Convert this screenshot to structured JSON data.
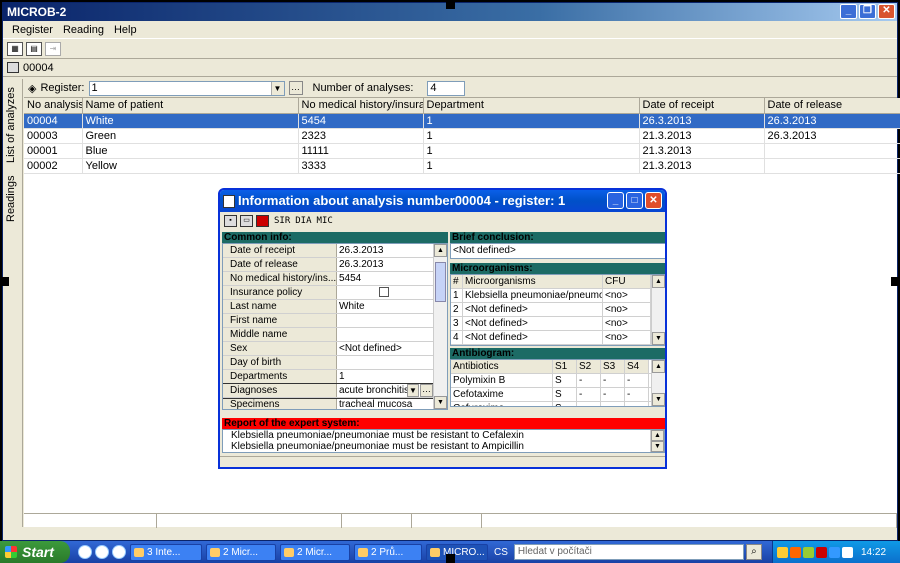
{
  "app": {
    "title": "MICROB-2"
  },
  "menu": [
    "Register",
    "Reading",
    "Help"
  ],
  "toolbar2_label": "00004",
  "side_tabs": [
    "List of analyzes",
    "Readings"
  ],
  "register_bar": {
    "register_label": "Register:",
    "register_value": "1",
    "count_label": "Number of analyses:",
    "count_value": "4"
  },
  "grid": {
    "columns": [
      "No analysis",
      "Name of patient",
      "No medical history/insuran...",
      "Department",
      "Date of receipt",
      "Date of release"
    ],
    "rows": [
      {
        "no": "00004",
        "name": "White",
        "history": "5454",
        "dept": "1",
        "receipt": "26.3.2013",
        "release": "26.3.2013",
        "selected": true
      },
      {
        "no": "00003",
        "name": "Green",
        "history": "2323",
        "dept": "1",
        "receipt": "21.3.2013",
        "release": "26.3.2013",
        "selected": false
      },
      {
        "no": "00001",
        "name": "Blue",
        "history": "11111",
        "dept": "1",
        "receipt": "21.3.2013",
        "release": "",
        "selected": false
      },
      {
        "no": "00002",
        "name": "Yellow",
        "history": "3333",
        "dept": "1",
        "receipt": "21.3.2013",
        "release": "",
        "selected": false
      }
    ]
  },
  "dialog": {
    "title": "Information about analysis number00004 - register: 1",
    "toolbar_text": [
      "SIR",
      "DIA",
      "MIC"
    ],
    "common_info": {
      "header": "Common info:",
      "fields": [
        {
          "label": "Date of receipt",
          "value": "26.3.2013"
        },
        {
          "label": "Date of release",
          "value": "26.3.2013"
        },
        {
          "label": "No medical history/ins...",
          "value": "5454"
        },
        {
          "label": "Insurance policy",
          "value": ""
        },
        {
          "label": "Last name",
          "value": "White"
        },
        {
          "label": "First name",
          "value": ""
        },
        {
          "label": "Middle name",
          "value": ""
        },
        {
          "label": "Sex",
          "value": "<Not defined>"
        },
        {
          "label": "Day of birth",
          "value": ""
        },
        {
          "label": "Departments",
          "value": "1"
        },
        {
          "label": "Diagnoses",
          "value": "acute bronchitis"
        },
        {
          "label": "Specimens",
          "value": "tracheal mucosa"
        }
      ]
    },
    "brief": {
      "header": "Brief conclusion:",
      "value": "<Not defined>"
    },
    "micro": {
      "header": "Microorganisms:",
      "columns": [
        "#",
        "Microorganisms",
        "CFU"
      ],
      "rows": [
        {
          "n": "1",
          "name": "Klebsiella pneumoniae/pneumor",
          "cfu": "<no>"
        },
        {
          "n": "2",
          "name": "<Not defined>",
          "cfu": "<no>"
        },
        {
          "n": "3",
          "name": "<Not defined>",
          "cfu": "<no>"
        },
        {
          "n": "4",
          "name": "<Not defined>",
          "cfu": "<no>"
        }
      ]
    },
    "antibiogram": {
      "header": "Antibiogram:",
      "columns": [
        "Antibiotics",
        "S1",
        "S2",
        "S3",
        "S4"
      ],
      "rows": [
        {
          "name": "Polymixin B",
          "s1": "S",
          "s2": "-",
          "s3": "-",
          "s4": "-"
        },
        {
          "name": "Cefotaxime",
          "s1": "S",
          "s2": "-",
          "s3": "-",
          "s4": "-"
        },
        {
          "name": "Cefuroxime",
          "s1": "S",
          "s2": "-",
          "s3": "-",
          "s4": "-"
        }
      ]
    },
    "expert": {
      "header": "Report of the expert system:",
      "lines": [
        "Klebsiella pneumoniae/pneumoniae must be resistant to Cefalexin",
        "Klebsiella pneumoniae/pneumoniae must be resistant to Ampicillin"
      ]
    }
  },
  "taskbar": {
    "start": "Start",
    "tasks": [
      "3 Inte...",
      "2 Micr...",
      "2 Micr...",
      "2 Prů...",
      "MICRO..."
    ],
    "lang": "CS",
    "search_placeholder": "Hledat v počítači",
    "clock": "14:22"
  }
}
